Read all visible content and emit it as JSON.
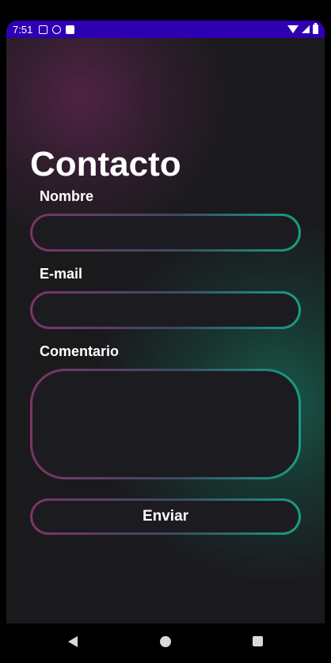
{
  "status_bar": {
    "time": "7:51",
    "left_icons": [
      "a-icon",
      "p-icon",
      "sd-card-icon"
    ],
    "right_icons": [
      "wifi-icon",
      "cell-signal-icon",
      "battery-icon"
    ],
    "color": "#2f00b3"
  },
  "page": {
    "title": "Contacto"
  },
  "form": {
    "name_label": "Nombre",
    "email_label": "E-mail",
    "comment_label": "Comentario",
    "name_value": "",
    "email_value": "",
    "comment_value": "",
    "submit_label": "Enviar"
  },
  "colors": {
    "background": "#1a1a1d",
    "gradient_start": "#7c3466",
    "gradient_end": "#169e84",
    "text": "#ffffff"
  },
  "nav_bar": {
    "icons": [
      "back-icon",
      "home-icon",
      "recents-icon"
    ]
  }
}
